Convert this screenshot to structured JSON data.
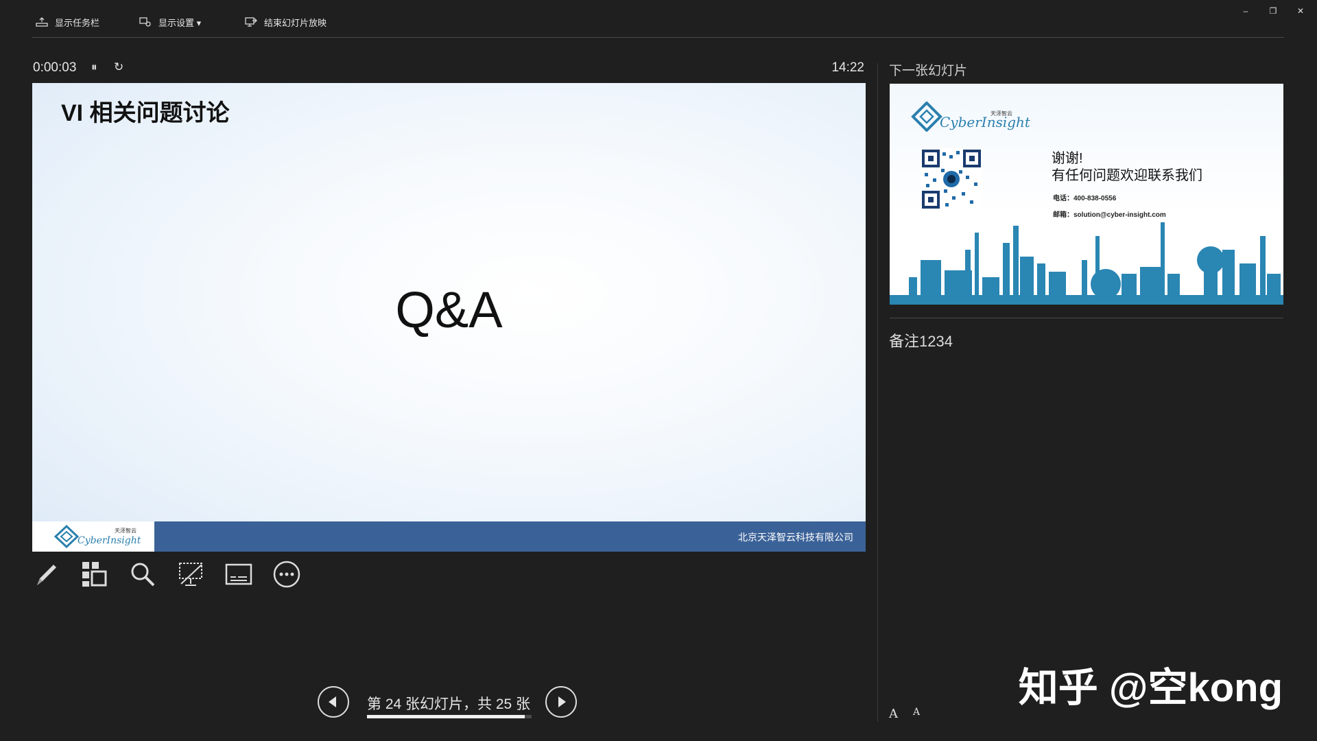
{
  "toolbar": {
    "show_taskbar": "显示任务栏",
    "display_settings": "显示设置 ▾",
    "end_show": "结束幻灯片放映"
  },
  "window_controls": {
    "minimize": "–",
    "restore": "❐",
    "close": "✕"
  },
  "timer": {
    "elapsed": "0:00:03",
    "pause": "⏸",
    "reset": "↻",
    "clock": "14:22"
  },
  "current_slide": {
    "title": "VI 相关问题讨论",
    "body": "Q&A",
    "footer_company": "北京天泽智云科技有限公司",
    "logo_text": "CyberInsight",
    "logo_cn": "天泽智云"
  },
  "tools": [
    {
      "name": "pen-icon"
    },
    {
      "name": "see-all-slides-icon"
    },
    {
      "name": "zoom-icon"
    },
    {
      "name": "black-screen-icon"
    },
    {
      "name": "subtitles-icon"
    },
    {
      "name": "more-options-icon"
    }
  ],
  "navigation": {
    "counter": "第 24 张幻灯片，共 25 张",
    "current": 24,
    "total": 25
  },
  "next_slide": {
    "label": "下一张幻灯片",
    "logo_text": "CyberInsight",
    "logo_cn": "天泽智云",
    "thanks": "谢谢!",
    "contact_line": "有任何问题欢迎联系我们",
    "phone": "电话：400-838-0556",
    "email": "邮箱：solution@cyber-insight.com"
  },
  "notes": {
    "text": "备注1234"
  },
  "font_controls": {
    "increase": "A",
    "decrease": "A"
  },
  "watermark": "知乎 @空kong",
  "colors": {
    "background": "#1f1f1f",
    "footer_blue": "#3b6298",
    "skyline_blue": "#2a86b3"
  }
}
